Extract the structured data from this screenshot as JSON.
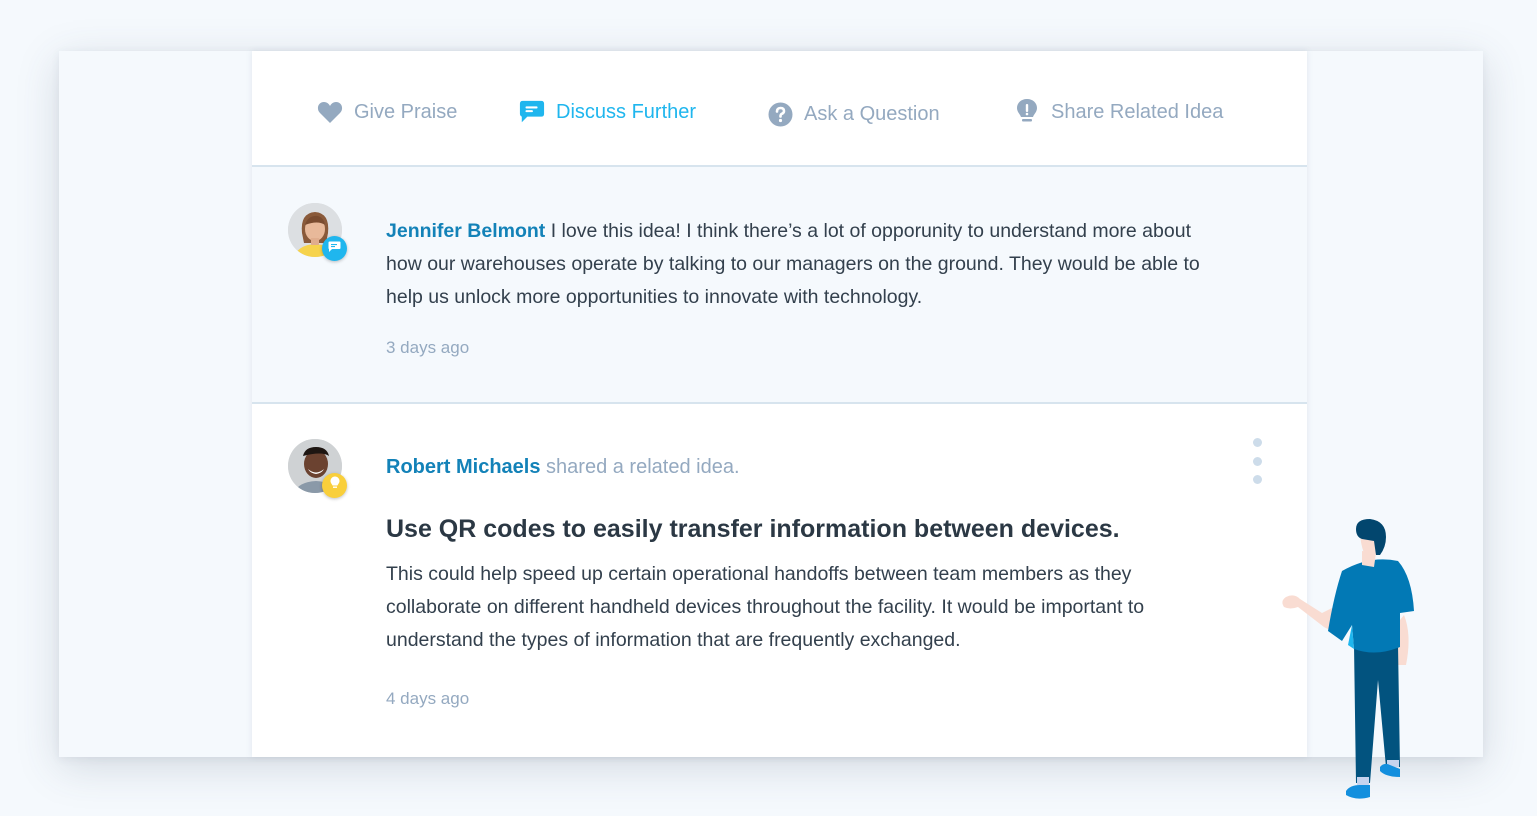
{
  "actions": [
    {
      "label": "Give Praise",
      "icon": "heart-icon",
      "active": false
    },
    {
      "label": "Discuss Further",
      "icon": "chat-bubble-icon",
      "active": true
    },
    {
      "label": "Ask a Question",
      "icon": "question-circle-icon",
      "active": false
    },
    {
      "label": "Share Related Idea",
      "icon": "lightbulb-icon",
      "active": false
    }
  ],
  "comments": [
    {
      "author": "Jennifer Belmont",
      "text": " I love this idea! I think there’s a lot of opporunity to understand more about how our warehouses operate by talking to our managers on the ground. They would be able to help us unlock more opportunities to innovate with technology.",
      "badge_icon": "chat-bubble-icon",
      "time": "3 days ago"
    },
    {
      "author": "Robert Michaels",
      "action_text": " shared a related idea.",
      "badge_icon": "lightbulb-icon",
      "idea_title": "Use QR codes to easily transfer information between devices.",
      "text": "This could help speed up certain operational handoffs between team members as they collaborate on different handheld devices throughout the facility. It would be important to understand the types of information that are frequently exchanged.",
      "time": "4 days ago"
    }
  ],
  "colors": {
    "accent": "#1fb6ee",
    "author": "#1382b8",
    "muted": "#94a9c0",
    "idea_badge": "#f9cf3b",
    "background": "#f5f9fd"
  }
}
